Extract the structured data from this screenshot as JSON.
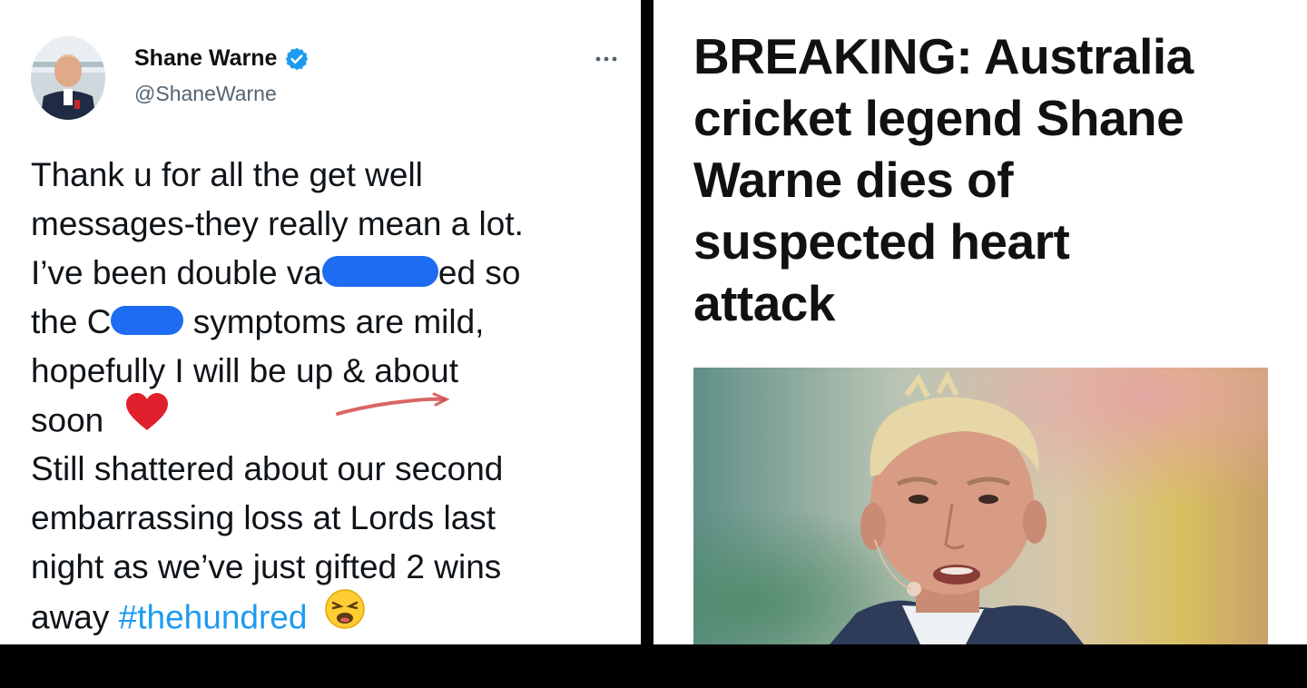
{
  "tweet": {
    "display_name": "Shane Warne",
    "handle": "@ShaneWarne",
    "more_icon": "more-horizontal-icon",
    "verified_icon": "verified-badge-icon",
    "lines": [
      {
        "text": "Thank u for all the get well"
      },
      {
        "text": "messages-they really mean a lot."
      },
      {
        "pre": "I’ve been double va",
        "post": "ed so"
      },
      {
        "pre": "the C",
        "post": " symptoms are mild,"
      },
      {
        "text": "hopefully I will be up & about"
      },
      {
        "text": "soon"
      },
      {
        "text": "Still shattered about our second"
      },
      {
        "text": "embarrassing loss at Lords last"
      },
      {
        "text": "night as we’ve just gifted 2 wins"
      },
      {
        "pre": "away ",
        "hashtag": "#thehundred"
      }
    ],
    "emoji": {
      "heart": "red-heart-icon",
      "weary": "weary-face-icon"
    }
  },
  "article": {
    "headline_lines": [
      "BREAKING: Australia",
      "cricket legend Shane",
      "Warne dies of",
      "suspected heart",
      "attack"
    ],
    "photo": "portrait-photo"
  },
  "colors": {
    "link": "#1d9bf0",
    "redaction": "#1d6cf2",
    "verified": "#1d9bf0",
    "heart": "#e0202c"
  }
}
